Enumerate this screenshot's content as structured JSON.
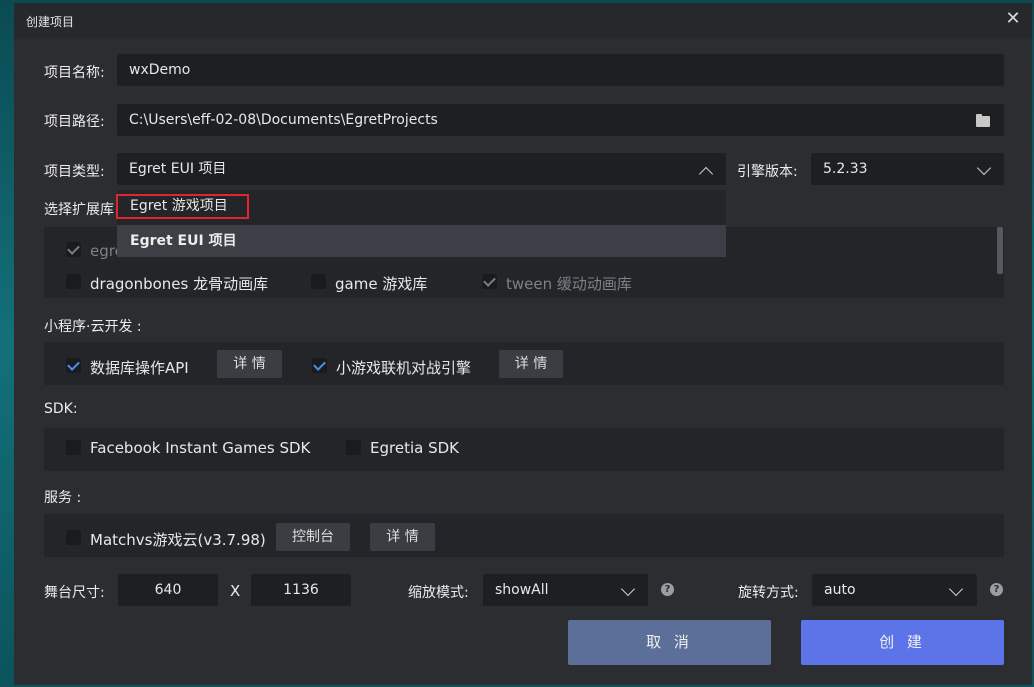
{
  "window": {
    "title": "创建项目"
  },
  "project_name": {
    "label": "项目名称:",
    "value": "wxDemo"
  },
  "project_path": {
    "label": "项目路径:",
    "value": "C:\\Users\\eff-02-08\\Documents\\EgretProjects",
    "icon": "folder-icon"
  },
  "project_type": {
    "label": "项目类型:",
    "value": "Egret EUI 项目",
    "options": [
      "Egret 游戏项目",
      "Egret EUI 项目"
    ],
    "selected_index": 1
  },
  "engine_version": {
    "label": "引擎版本:",
    "value": "5.2.33"
  },
  "extensions": {
    "label": "选择扩展库",
    "items": [
      {
        "label": "egret",
        "checked": true,
        "disabled": true
      },
      {
        "label": "dragonbones 龙骨动画库",
        "checked": false,
        "disabled": false
      },
      {
        "label": "game 游戏库",
        "checked": false,
        "disabled": false
      },
      {
        "label": "tween 缓动动画库",
        "checked": true,
        "disabled": true
      }
    ]
  },
  "cloud": {
    "label": "小程序·云开发 :",
    "items": [
      {
        "label": "数据库操作API",
        "checked": true,
        "button": "详 情"
      },
      {
        "label": "小游戏联机对战引擎",
        "checked": true,
        "button": "详 情"
      }
    ]
  },
  "sdk": {
    "label": "SDK:",
    "items": [
      {
        "label": "Facebook Instant Games SDK",
        "checked": false
      },
      {
        "label": "Egretia SDK",
        "checked": false
      }
    ]
  },
  "services": {
    "label": "服务 :",
    "item": {
      "label": "Matchvs游戏云(v3.7.98)",
      "checked": false
    },
    "console_button": "控制台",
    "detail_button": "详 情"
  },
  "stage": {
    "label": "舞台尺寸:",
    "width": "640",
    "separator": "X",
    "height": "1136",
    "scale_label": "缩放模式:",
    "scale_value": "showAll",
    "rotate_label": "旋转方式:",
    "rotate_value": "auto",
    "help_glyph": "?"
  },
  "actions": {
    "cancel": "取 消",
    "create": "创 建"
  },
  "colors": {
    "cancel_bg": "#5b6f99",
    "create_bg": "#5d74e8",
    "highlight": "#e0262c",
    "check": "#4d8ee8"
  }
}
